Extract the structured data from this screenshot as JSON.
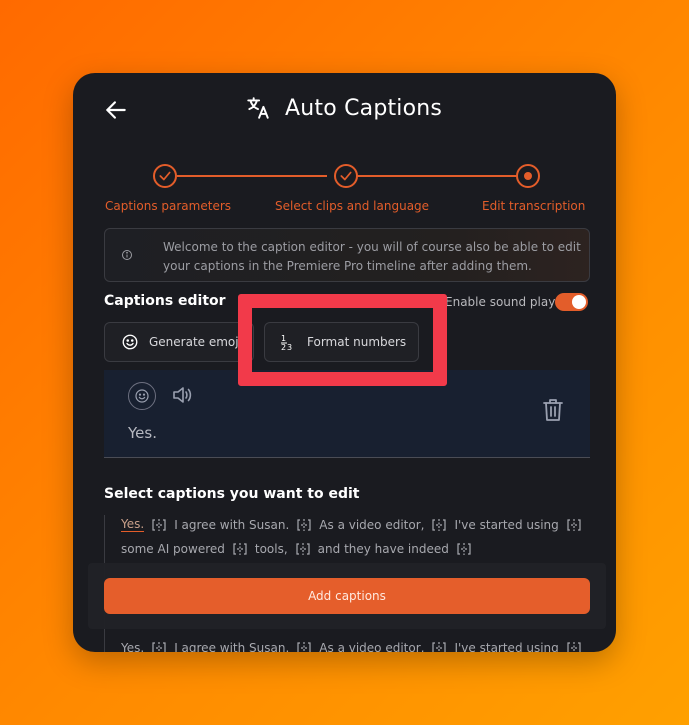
{
  "header": {
    "title": "Auto Captions",
    "back_icon": "arrow-left-icon",
    "title_icon": "translate-icon"
  },
  "stepper": {
    "accent": "#e35d2a",
    "steps": [
      {
        "label": "Captions parameters",
        "state": "done"
      },
      {
        "label": "Select clips and language",
        "state": "done"
      },
      {
        "label": "Edit transcription",
        "state": "current"
      }
    ]
  },
  "info": {
    "text": "Welcome to the caption editor - you will of course also be able to edit your captions in the Premiere Pro timeline after adding them."
  },
  "editor": {
    "title": "Captions editor",
    "sound_label": "Enable sound play",
    "sound_enabled": true,
    "generate_emojis_label": "Generate emojis",
    "format_numbers_label": "Format numbers"
  },
  "caption_card": {
    "text": "Yes."
  },
  "select": {
    "title": "Select captions you want to edit",
    "line1": [
      "Yes.",
      "I agree with Susan.",
      "As a video editor,",
      "I've started using"
    ],
    "line2": [
      "some AI powered",
      "tools,",
      "and they have indeed"
    ],
    "line3": [
      "Yes.",
      "I agree with Susan.",
      "As a video editor,",
      "I've started using"
    ]
  },
  "footer": {
    "add_label": "Add captions"
  },
  "colors": {
    "highlight": "#f23a4a",
    "panel": "#1a1b20",
    "button": "#e55e2b"
  }
}
